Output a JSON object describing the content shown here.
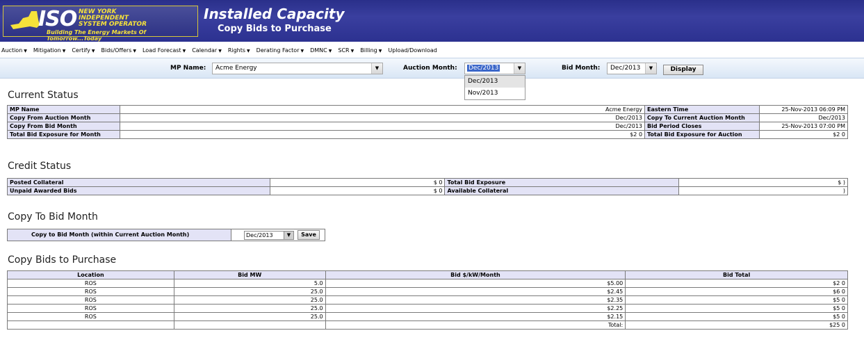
{
  "header": {
    "logo_text": "ISO",
    "logo_lines": [
      "NEW YORK",
      "INDEPENDENT",
      "SYSTEM OPERATOR"
    ],
    "logo_tagline": "Building The Energy Markets Of Tomorrow...Today",
    "title": "Installed Capacity",
    "subtitle": "Copy Bids to Purchase"
  },
  "nav": [
    "Auction",
    "Mitigation",
    "Certify",
    "Bids/Offers",
    "Load Forecast",
    "Calendar",
    "Rights",
    "Derating Factor",
    "DMNC",
    "SCR",
    "Billing",
    "Upload/Download"
  ],
  "filters": {
    "mp_label": "MP Name:",
    "mp_value": "Acme Energy",
    "auction_label": "Auction Month:",
    "auction_value": "Dec/2013",
    "auction_options": [
      "Dec/2013",
      "Nov/2013"
    ],
    "bid_label": "Bid Month:",
    "bid_value": "Dec/2013",
    "display_label": "Display"
  },
  "current_status": {
    "title": "Current Status",
    "rows": [
      {
        "label": "MP Name",
        "value": "Acme Energy",
        "label2": "Eastern Time",
        "value2": "25-Nov-2013 06:09 PM"
      },
      {
        "label": "Copy From Auction Month",
        "value": "Dec/2013",
        "label2": "Copy To Current Auction Month",
        "value2": "Dec/2013"
      },
      {
        "label": "Copy From Bid Month",
        "value": "Dec/2013",
        "label2": "Bid Period Closes",
        "value2": "25-Nov-2013 07:00 PM"
      },
      {
        "label": "Total Bid Exposure for Month",
        "value": "$2       0",
        "label2": "Total Bid Exposure for Auction",
        "value2": "$2       0"
      }
    ]
  },
  "credit_status": {
    "title": "Credit Status",
    "rows": [
      {
        "label": "Posted Collateral",
        "value": "$         0",
        "label2": "Total Bid Exposure",
        "value2": "$          )"
      },
      {
        "label": "Unpaid Awarded Bids",
        "value": "$         0",
        "label2": "Available Collateral",
        "value2": "           )"
      }
    ]
  },
  "copy_to": {
    "title": "Copy To Bid Month",
    "label": "Copy to Bid Month (within Current Auction Month)",
    "select_value": "Dec/2013",
    "save_label": "Save"
  },
  "bids": {
    "title": "Copy Bids to Purchase",
    "headers": [
      "Location",
      "Bid MW",
      "Bid $/kW/Month",
      "Bid Total"
    ],
    "rows": [
      [
        "ROS",
        "5.0",
        "$5.00",
        "$2        0"
      ],
      [
        "ROS",
        "25.0",
        "$2.45",
        "$6        0"
      ],
      [
        "ROS",
        "25.0",
        "$2.35",
        "$5        0"
      ],
      [
        "ROS",
        "25.0",
        "$2.25",
        "$5        0"
      ],
      [
        "ROS",
        "25.0",
        "$2.15",
        "$5        0"
      ]
    ],
    "total_label": "Total:",
    "total_value": "$25        0"
  }
}
